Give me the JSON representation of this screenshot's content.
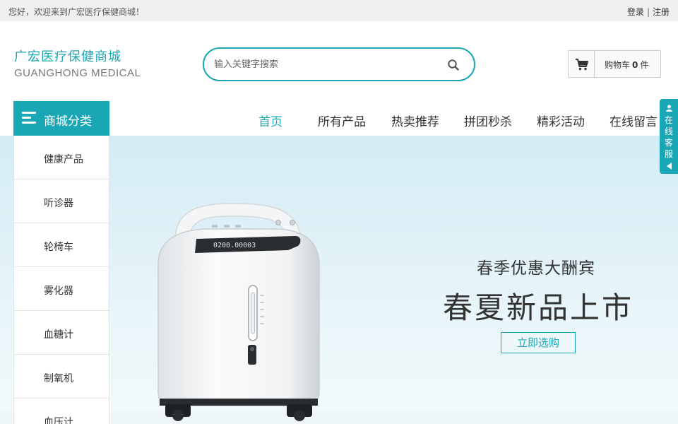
{
  "topbar": {
    "welcome": "您好，欢迎来到广宏医疗保健商城！",
    "login": "登录",
    "separator": "|",
    "register": "注册"
  },
  "header": {
    "logo_cn": "广宏医疗保健商城",
    "logo_en": "GUANGHONG MEDICAL",
    "search_placeholder": "输入关键字搜索",
    "search_icon": "search-icon",
    "cart_label": "购物车",
    "cart_count": "0",
    "cart_unit": "件",
    "cart_icon": "cart-icon"
  },
  "nav": {
    "category_title": "商城分类",
    "items": [
      "首页",
      "所有产品",
      "热卖推荐",
      "拼团秒杀",
      "精彩活动",
      "在线留言"
    ],
    "active_index": 0
  },
  "sidebar": {
    "categories": [
      "健康产品",
      "听诊器",
      "轮椅车",
      "雾化器",
      "血糖计",
      "制氧机",
      "血压计"
    ]
  },
  "banner": {
    "subtitle": "春季优惠大酬宾",
    "title": "春夏新品上市",
    "button": "立即选购",
    "product_display": "0200.00003"
  },
  "service": {
    "label": "在线客服"
  },
  "colors": {
    "accent": "#1aa7b5",
    "topbar_bg": "#f0f0f0",
    "banner_bg": "#d3ecf4"
  }
}
